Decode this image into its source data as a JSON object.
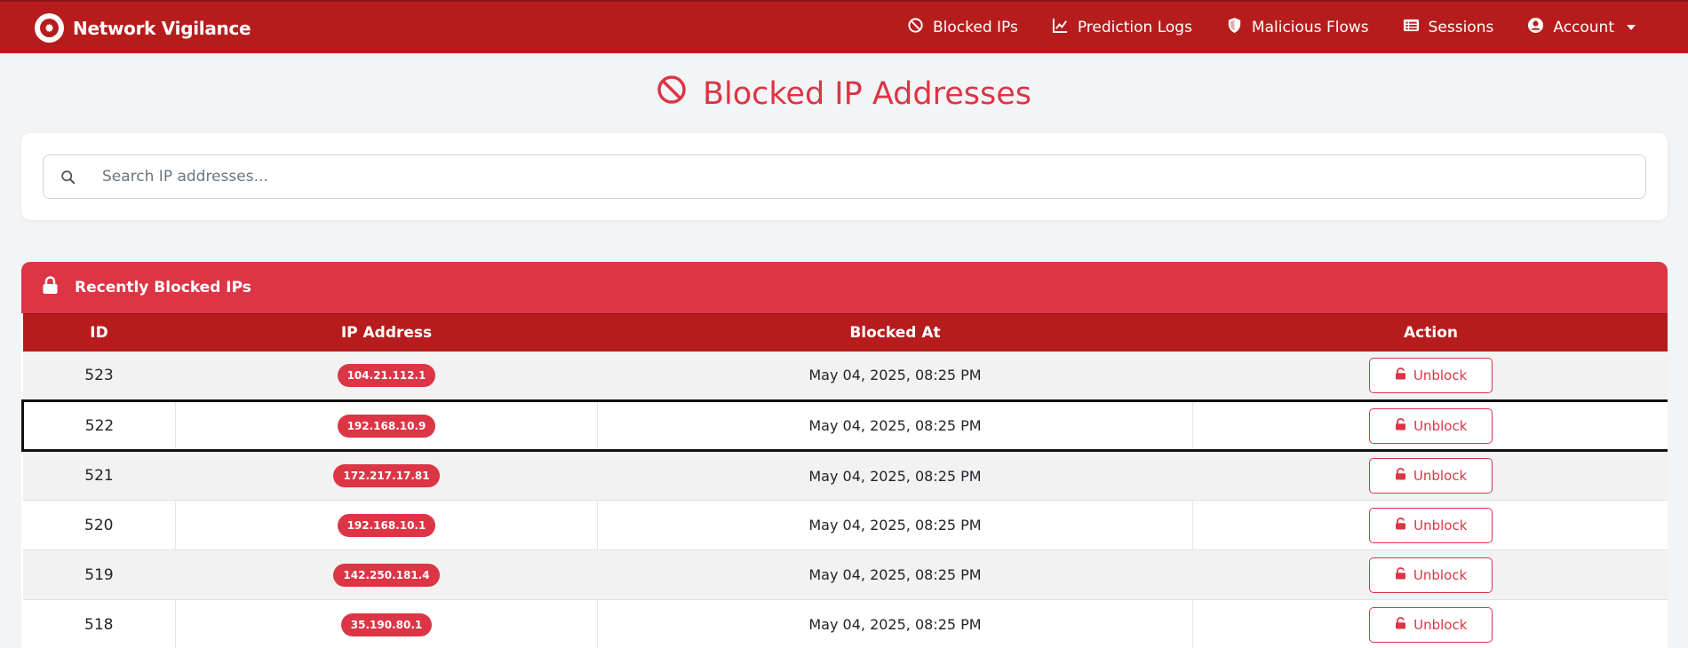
{
  "navbar": {
    "brand": "Network Vigilance",
    "items": [
      {
        "label": "Blocked IPs",
        "icon": "ban-icon"
      },
      {
        "label": "Prediction Logs",
        "icon": "chart-line-icon"
      },
      {
        "label": "Malicious Flows",
        "icon": "shield-icon"
      },
      {
        "label": "Sessions",
        "icon": "list-icon"
      },
      {
        "label": "Account",
        "icon": "user-circle-icon"
      }
    ]
  },
  "page": {
    "title": "Blocked IP Addresses"
  },
  "search": {
    "placeholder": "Search IP addresses..."
  },
  "table": {
    "header_title": "Recently Blocked IPs",
    "columns": [
      "ID",
      "IP Address",
      "Blocked At",
      "Action"
    ],
    "action_label": "Unblock",
    "rows": [
      {
        "id": "523",
        "ip": "104.21.112.1",
        "blocked_at": "May 04, 2025, 08:25 PM"
      },
      {
        "id": "522",
        "ip": "192.168.10.9",
        "blocked_at": "May 04, 2025, 08:25 PM"
      },
      {
        "id": "521",
        "ip": "172.217.17.81",
        "blocked_at": "May 04, 2025, 08:25 PM"
      },
      {
        "id": "520",
        "ip": "192.168.10.1",
        "blocked_at": "May 04, 2025, 08:25 PM"
      },
      {
        "id": "519",
        "ip": "142.250.181.4",
        "blocked_at": "May 04, 2025, 08:25 PM"
      },
      {
        "id": "518",
        "ip": "35.190.80.1",
        "blocked_at": "May 04, 2025, 08:25 PM"
      }
    ]
  },
  "colors": {
    "navbar": "#b71c1c",
    "accent": "#dc3545",
    "background": "#f3f4f6"
  }
}
